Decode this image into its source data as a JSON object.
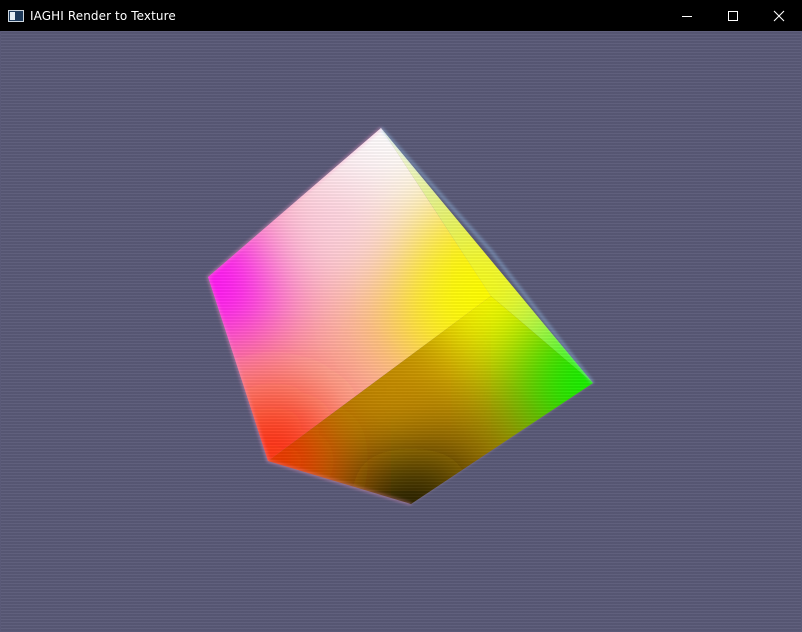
{
  "window": {
    "title": "IAGHI Render to Texture",
    "icon": "app-window-icon",
    "controls": {
      "minimize_icon": "minimize-icon",
      "maximize_icon": "maximize-icon",
      "close_icon": "close-icon"
    }
  },
  "scene": {
    "background_color": "#5a5a78",
    "object": "rgb-color-cube",
    "vertex_colors": {
      "top": "#ffffff",
      "left": "#ff00ff",
      "center": "#ffff00",
      "bottom_left": "#ff2200",
      "bottom": "#000000",
      "right": "#00ff00"
    }
  }
}
